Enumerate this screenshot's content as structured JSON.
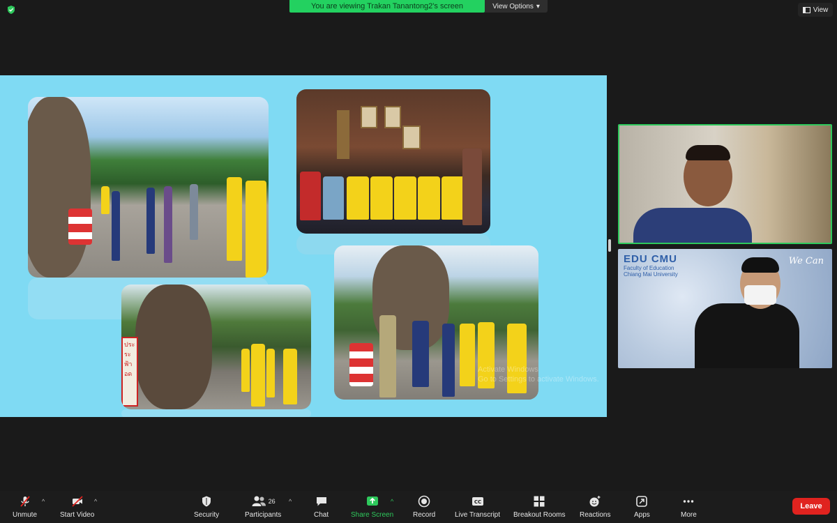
{
  "top": {
    "banner": "You are viewing Trakan Tanantong2's screen",
    "view_options": "View Options",
    "view": "View"
  },
  "shared_screen": {
    "watermark_line1": "Activate Windows",
    "watermark_line2": "Go to Settings to activate Windows."
  },
  "participants": {
    "tile2_logo_title": "EDU CMU",
    "tile2_logo_sub1": "Faculty of Education",
    "tile2_logo_sub2": "Chiang Mai University",
    "tile2_brand": "We Can"
  },
  "toolbar": {
    "unmute": "Unmute",
    "start_video": "Start Video",
    "security": "Security",
    "participants": "Participants",
    "participants_count": "26",
    "chat": "Chat",
    "share_screen": "Share Screen",
    "record": "Record",
    "live_transcript": "Live Transcript",
    "breakout_rooms": "Breakout Rooms",
    "reactions": "Reactions",
    "apps": "Apps",
    "more": "More",
    "leave": "Leave"
  },
  "colors": {
    "banner_green": "#23d160",
    "share_green": "#2ec95c",
    "leave_red": "#e0231f",
    "slide_bg": "#7fdaf3"
  }
}
